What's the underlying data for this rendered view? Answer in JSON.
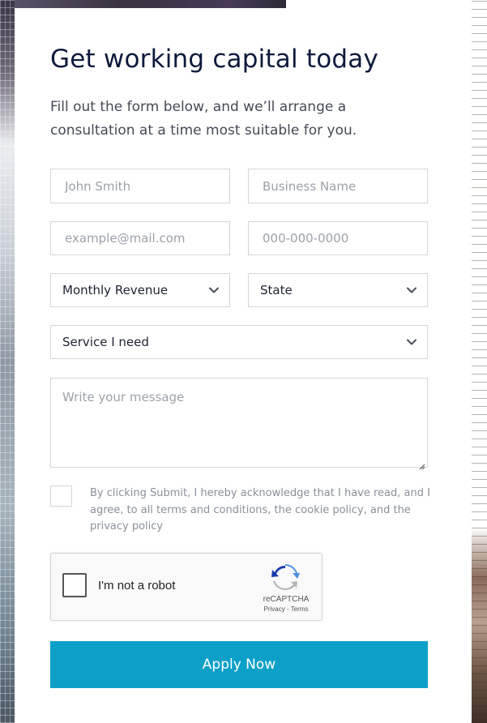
{
  "form": {
    "title": "Get working capital today",
    "subtitle": "Fill out the form below, and we’ll arrange a consultation at a time most suitable for you.",
    "name_placeholder": "John Smith",
    "business_placeholder": "Business Name",
    "email_placeholder": "example@mail.com",
    "phone_placeholder": "000-000-0000",
    "revenue_select": "Monthly Revenue",
    "state_select": "State",
    "service_select": "Service I need",
    "message_placeholder": "Write your message",
    "consent_text": "By clicking Submit, I hereby acknowledge that I have read, and I agree, to all terms and conditions, the cookie policy, and the privacy policy",
    "submit_label": "Apply Now"
  },
  "recaptcha": {
    "label": "I'm not a robot",
    "brand": "reCAPTCHA",
    "links": "Privacy - Terms"
  },
  "colors": {
    "accent": "#0ca0c8",
    "title": "#0e1a3c",
    "border": "#d3d6dc"
  }
}
